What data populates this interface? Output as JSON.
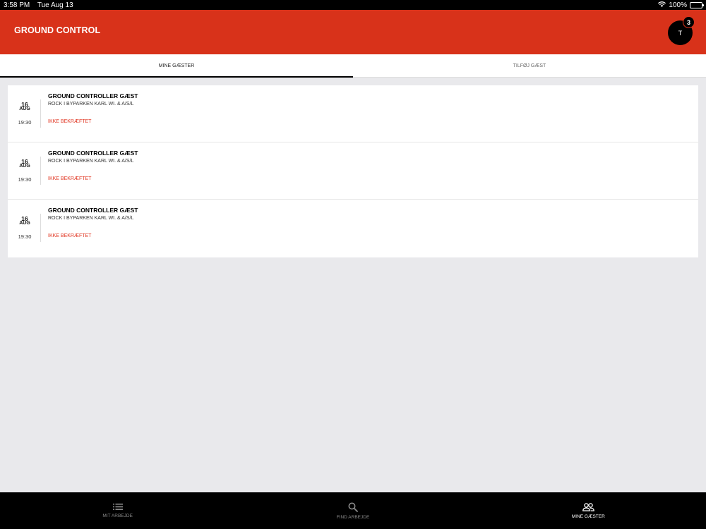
{
  "status_bar": {
    "time": "3:58 PM",
    "date": "Tue Aug 13",
    "battery": "100%"
  },
  "header": {
    "title": "GROUND CONTROL",
    "avatar_initial": "T",
    "notification_count": "3"
  },
  "tabs": [
    {
      "label": "MINE GÆSTER"
    },
    {
      "label": "TILFØJ GÆST"
    }
  ],
  "guests": [
    {
      "day": "16",
      "month": "AUG",
      "time": "19:30",
      "name": "GROUND CONTROLLER GÆST",
      "venue": "ROCK I BYPARKEN KARL WI. & A/S/L",
      "status": "IKKE BEKRÆFTET"
    },
    {
      "day": "16",
      "month": "AUG",
      "time": "19:30",
      "name": "GROUND CONTROLLER GÆST",
      "venue": "ROCK I BYPARKEN KARL WI. & A/S/L",
      "status": "IKKE BEKRÆFTET"
    },
    {
      "day": "16",
      "month": "AUG",
      "time": "19:30",
      "name": "GROUND CONTROLLER GÆST",
      "venue": "ROCK I BYPARKEN KARL WI. & A/S/L",
      "status": "IKKE BEKRÆFTET"
    }
  ],
  "bottom_nav": [
    {
      "label": "MIT ARBEJDE",
      "icon": "list-icon"
    },
    {
      "label": "FIND ARBEJDE",
      "icon": "search-icon"
    },
    {
      "label": "MINE GÆSTER",
      "icon": "people-icon"
    }
  ],
  "colors": {
    "brand_red": "#d8321a",
    "status_red": "#e0321e",
    "background": "#e9e9ec"
  }
}
